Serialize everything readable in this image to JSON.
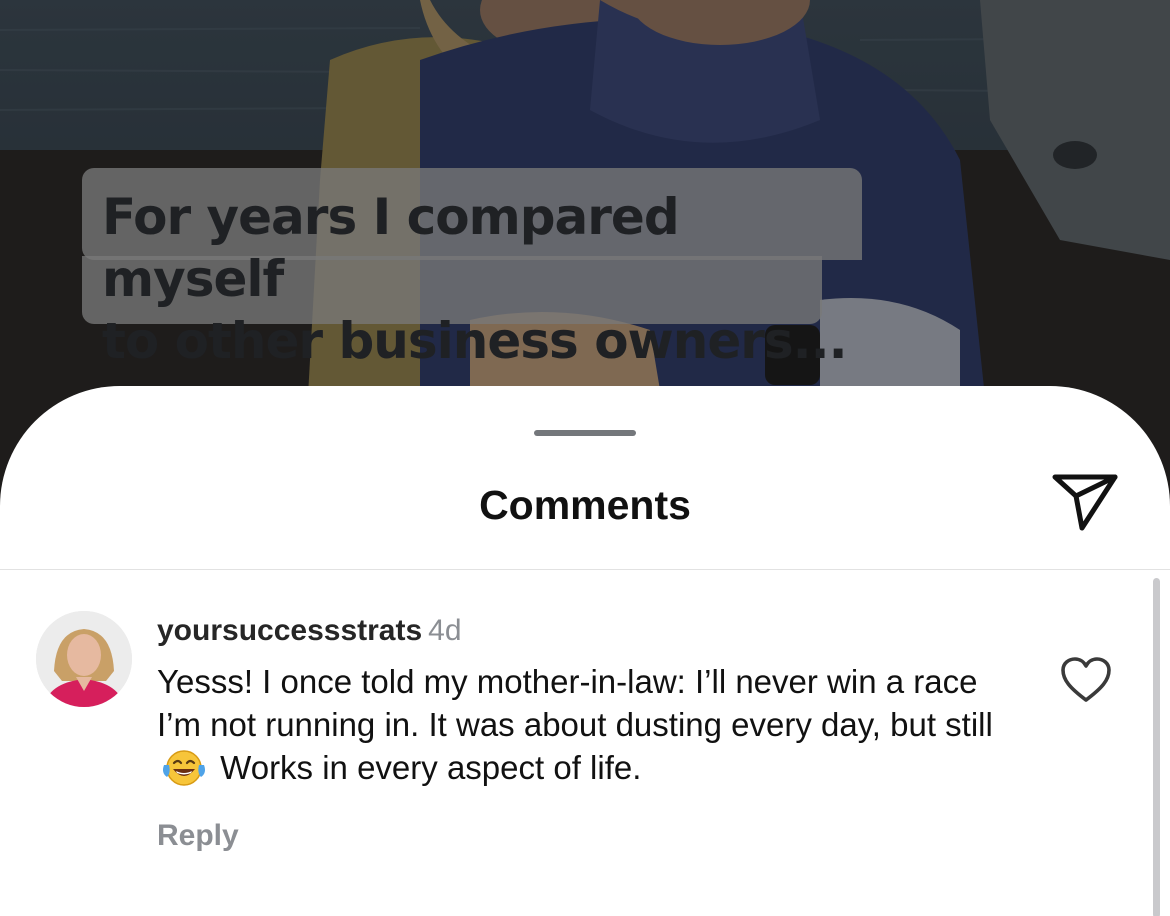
{
  "video": {
    "caption_lines": "For years I compared myself\nto other business owners..."
  },
  "sheet": {
    "title": "Comments",
    "share_icon": "paper-plane-icon"
  },
  "comment": {
    "username": "yoursuccessstrats",
    "timestamp": "4d",
    "text_part1": "Yesss! I once told my mother-in-law: I’ll never win a race I’m not running in. It was about dusting every day, but still ",
    "emoji": "face-with-tears-of-joy",
    "text_part2": " Works in every aspect of life.",
    "reply_label": "Reply",
    "like_icon": "heart-outline-icon"
  },
  "colors": {
    "text_primary": "#111111",
    "text_secondary": "#8b8e93",
    "sheet_background": "#ffffff"
  }
}
